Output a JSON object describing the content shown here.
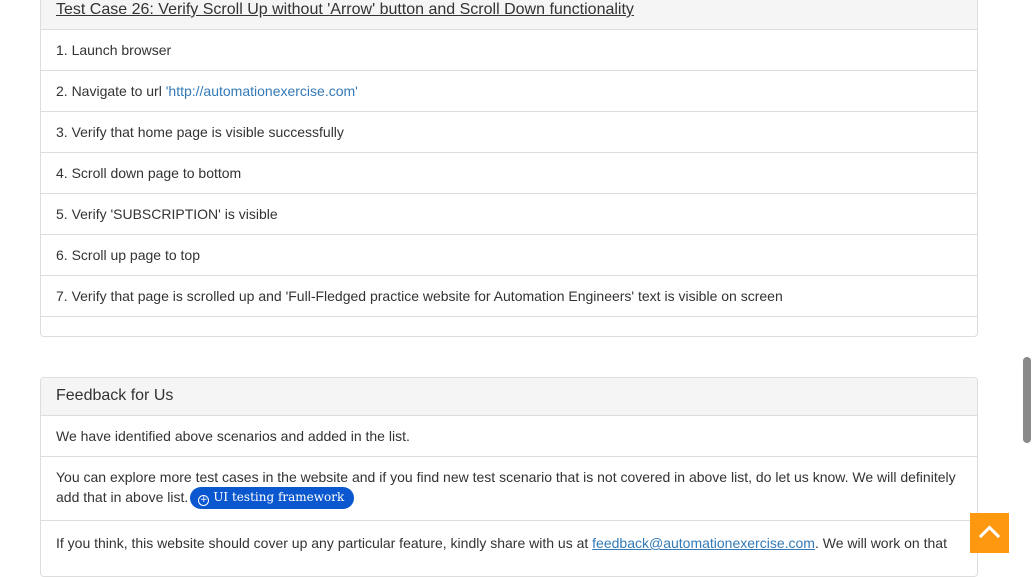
{
  "test_case": {
    "title": "Test Case 26: Verify Scroll Up without 'Arrow' button and Scroll Down functionality",
    "steps": [
      "1. Launch browser",
      "2. Navigate to url ",
      "3. Verify that home page is visible successfully",
      "4. Scroll down page to bottom",
      "5. Verify 'SUBSCRIPTION' is visible",
      "6. Scroll up page to top",
      "7. Verify that page is scrolled up and 'Full-Fledged practice website for Automation Engineers' text is visible on screen"
    ],
    "url_link": "'http://automationexercise.com'"
  },
  "feedback": {
    "heading": "Feedback for Us",
    "line1": "We have identified above scenarios and added in the list.",
    "line2_text": "You can explore more test cases in the website and if you find new test scenario that is not covered in above list, do let us know. We will definitely add that in above list.",
    "badge_label": "UI testing framework",
    "line3_prefix": "If you think, this website should cover up any particular feature, kindly share with us at ",
    "email": "feedback@automationexercise.com",
    "line3_suffix": ". We will work on that"
  },
  "colors": {
    "accent": "#fe980f",
    "link": "#337ab7",
    "badge": "#0b57d0"
  },
  "icons": {
    "scroll_up": "chevron-up-icon",
    "badge": "plus-circle-icon"
  }
}
